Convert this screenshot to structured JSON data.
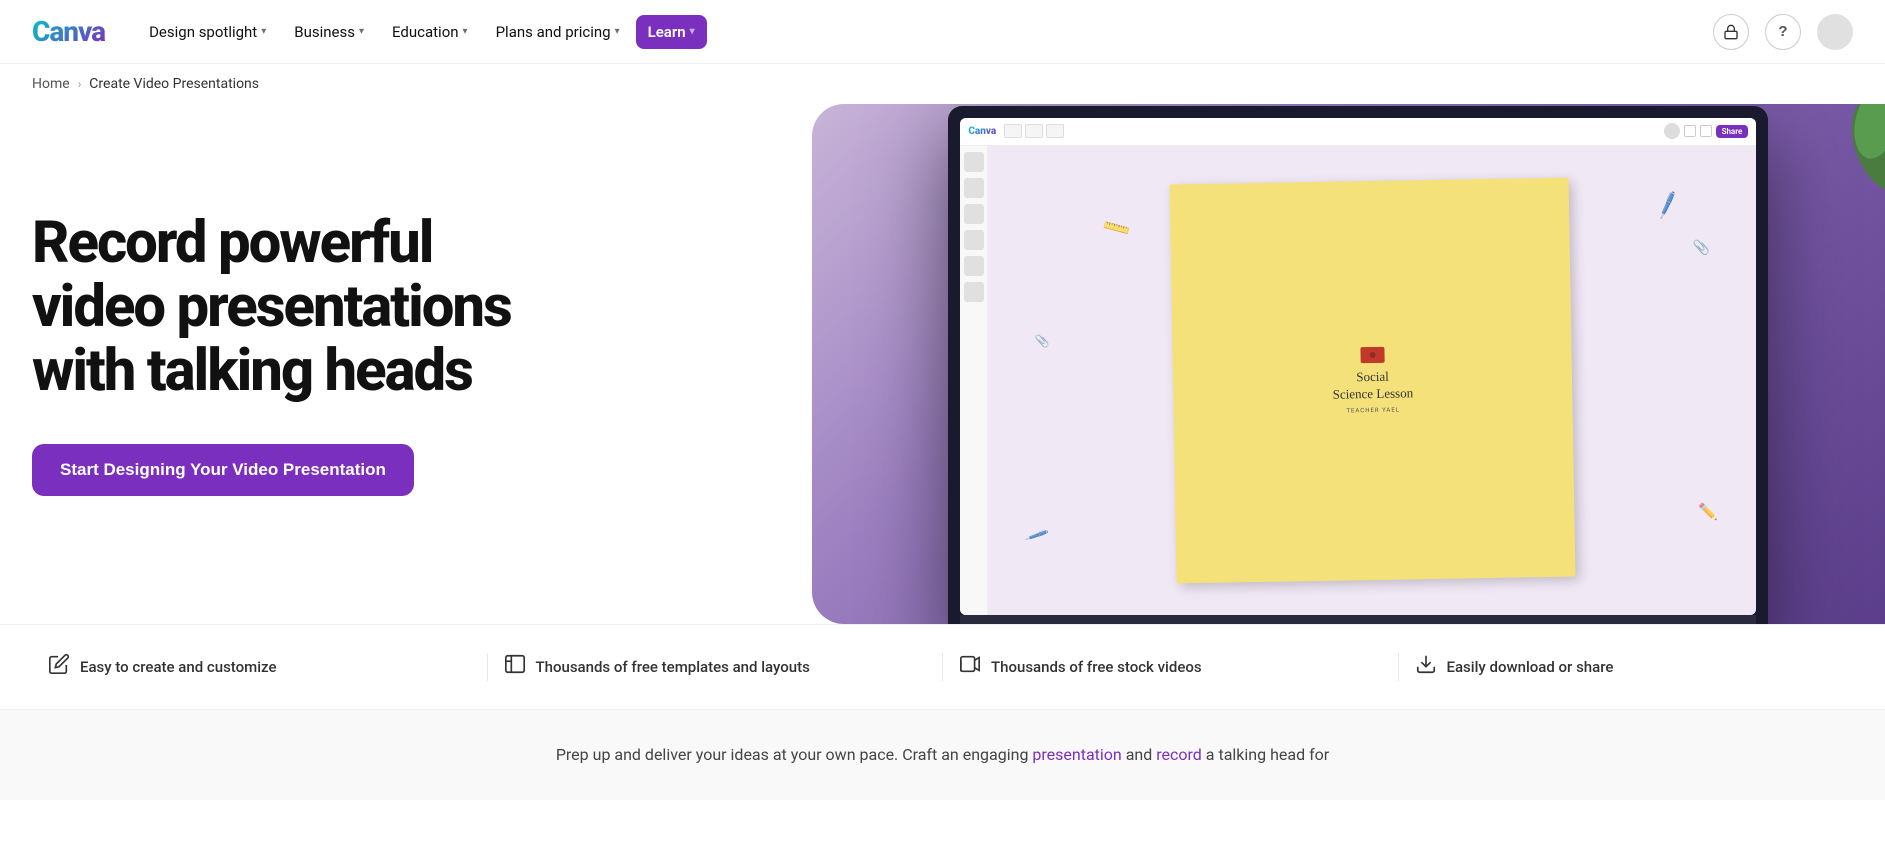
{
  "brand": {
    "name": "Canva",
    "logo_text": "Canva"
  },
  "nav": {
    "items": [
      {
        "id": "design-spotlight",
        "label": "Design spotlight",
        "has_dropdown": true
      },
      {
        "id": "business",
        "label": "Business",
        "has_dropdown": true
      },
      {
        "id": "education",
        "label": "Education",
        "has_dropdown": true
      },
      {
        "id": "plans-pricing",
        "label": "Plans and pricing",
        "has_dropdown": true
      },
      {
        "id": "learn",
        "label": "Learn",
        "has_dropdown": true,
        "active": true
      }
    ],
    "icons": {
      "lock": "🔒",
      "help": "?"
    }
  },
  "breadcrumb": {
    "home": "Home",
    "separator": "›",
    "current": "Create Video Presentations"
  },
  "hero": {
    "title_line1": "Record powerful",
    "title_line2": "video presentations",
    "title_line3": "with talking heads",
    "cta_label": "Start Designing Your Video Presentation"
  },
  "editor_mock": {
    "logo": "Canva",
    "share_btn": "Share",
    "slide": {
      "title": "Social",
      "title2": "Science Lesson",
      "author": "TEACHER YAEL"
    }
  },
  "features": [
    {
      "id": "easy-create",
      "icon": "✏️",
      "label": "Easy to create and customize"
    },
    {
      "id": "templates",
      "icon": "⬜",
      "label": "Thousands of free templates and layouts"
    },
    {
      "id": "stock-videos",
      "icon": "🖥️",
      "label": "Thousands of free stock videos"
    },
    {
      "id": "download-share",
      "icon": "⬇️",
      "label": "Easily download or share"
    }
  ],
  "bottom_teaser": {
    "text_before": "Prep up and deliver your ideas at your own pace. Craft an engaging ",
    "link1_text": "presentation",
    "link1_href": "#",
    "text_middle": " and ",
    "link2_text": "record",
    "link2_href": "#",
    "text_after": " a talking head for"
  }
}
